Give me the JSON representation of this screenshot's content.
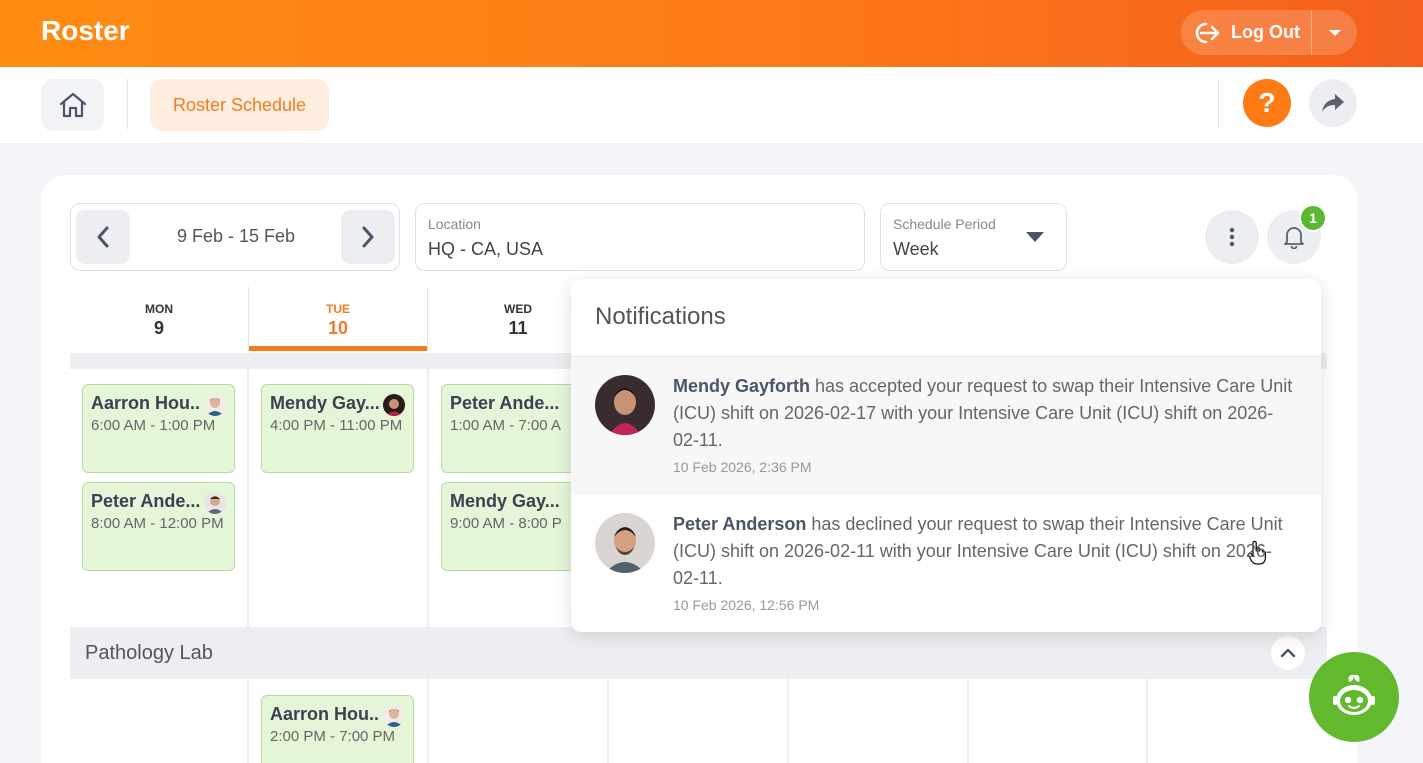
{
  "app": {
    "title": "Roster"
  },
  "header": {
    "logout_label": "Log Out"
  },
  "subnav": {
    "roster_schedule": "Roster Schedule",
    "help": "?"
  },
  "filters": {
    "date_range": "9 Feb - 15 Feb",
    "location_label": "Location",
    "location_value": "HQ - CA, USA",
    "period_label": "Schedule Period",
    "period_value": "Week"
  },
  "notification_count": "1",
  "days": [
    {
      "dow": "MON",
      "num": "9"
    },
    {
      "dow": "TUE",
      "num": "10"
    },
    {
      "dow": "WED",
      "num": "11"
    }
  ],
  "shifts": {
    "mon": [
      {
        "name": "Aarron Hou...",
        "time": "6:00 AM - 1:00 PM"
      },
      {
        "name": "Peter Ande...",
        "time": "8:00 AM - 12:00 PM"
      }
    ],
    "tue": [
      {
        "name": "Mendy Gay...",
        "time": "4:00 PM - 11:00 PM"
      }
    ],
    "wed": [
      {
        "name": "Peter Ande...",
        "time": "1:00 AM - 7:00 A"
      },
      {
        "name": "Mendy Gay...",
        "time": "9:00 AM - 8:00 P"
      }
    ],
    "pathology_tue": [
      {
        "name": "Aarron Hou...",
        "time": "2:00 PM - 7:00 PM"
      }
    ]
  },
  "section": {
    "title": "Pathology Lab"
  },
  "notifications": {
    "title": "Notifications",
    "items": [
      {
        "name": "Mendy Gayforth",
        "text": " has accepted your request to swap their Intensive Care Unit (ICU) shift on 2026-02-17 with your Intensive Care Unit (ICU) shift on 2026-02-11.",
        "time": "10 Feb 2026, 2:36 PM"
      },
      {
        "name": "Peter Anderson",
        "text": " has declined your request to swap their Intensive Care Unit (ICU) shift on 2026-02-11 with your Intensive Care Unit (ICU) shift on 2026-02-11.",
        "time": "10 Feb 2026, 12:56 PM"
      }
    ]
  },
  "colors": {
    "accent": "#f47b20",
    "shift_bg": "#e5f5d8",
    "badge": "#5bb832",
    "bot": "#62b92e"
  }
}
